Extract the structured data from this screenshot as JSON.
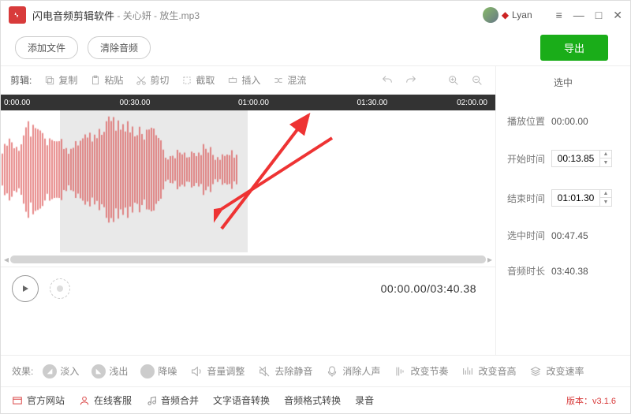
{
  "app": {
    "name": "闪电音频剪辑软件",
    "file": "关心妍 - 放生.mp3",
    "username": "Lyan",
    "version": "版本：v3.1.6"
  },
  "toolbar": {
    "add_file": "添加文件",
    "clear_audio": "清除音频",
    "export": "导出"
  },
  "edit": {
    "label": "剪辑:",
    "copy": "复制",
    "paste": "粘贴",
    "cut": "剪切",
    "crop": "截取",
    "insert": "插入",
    "mix": "混流"
  },
  "timeline": {
    "marks": [
      "0:00.00",
      "00:30.00",
      "01:00.00",
      "01:30.00",
      "02:00.00"
    ]
  },
  "selection_area": {
    "start_pct": 12,
    "end_pct": 50
  },
  "playback": {
    "time": "00:00.00/03:40.38"
  },
  "side": {
    "header": "选中",
    "pos_label": "播放位置",
    "pos_value": "00:00.00",
    "start_label": "开始时间",
    "start_value": "00:13.85",
    "end_label": "结束时间",
    "end_value": "01:01.30",
    "sel_label": "选中时间",
    "sel_value": "00:47.45",
    "dur_label": "音频时长",
    "dur_value": "03:40.38"
  },
  "effects": {
    "label": "效果:",
    "fadein": "淡入",
    "fadeout": "浅出",
    "denoise": "降噪",
    "volume": "音量调整",
    "trimsilence": "去除静音",
    "devocal": "消除人声",
    "tempo": "改变节奏",
    "pitch": "改变音高",
    "speed": "改变速率"
  },
  "footer": {
    "site": "官方网站",
    "support": "在线客服",
    "merge": "音频合并",
    "tts": "文字语音转换",
    "format": "音频格式转换",
    "record": "录音"
  }
}
